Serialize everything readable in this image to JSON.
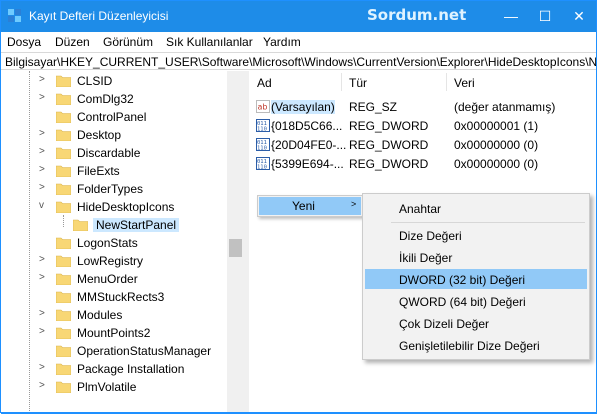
{
  "window": {
    "title": "Kayıt Defteri Düzenleyicisi",
    "brand": "Sordum.net",
    "accent_color": "#1e8ce8",
    "minimize_label": "—",
    "maximize_label": "☐",
    "close_label": "✕"
  },
  "menubar": {
    "items": [
      "Dosya",
      "Düzen",
      "Görünüm",
      "Sık Kullanılanlar",
      "Yardım"
    ]
  },
  "address": {
    "path": "Bilgisayar\\HKEY_CURRENT_USER\\Software\\Microsoft\\Windows\\CurrentVersion\\Explorer\\HideDesktopIcons\\NewStartPanel"
  },
  "tree": {
    "items": [
      {
        "label": "CLSID",
        "expander": ">"
      },
      {
        "label": "ComDlg32",
        "expander": ">"
      },
      {
        "label": "ControlPanel",
        "expander": ""
      },
      {
        "label": "Desktop",
        "expander": ">"
      },
      {
        "label": "Discardable",
        "expander": ">"
      },
      {
        "label": "FileExts",
        "expander": ">"
      },
      {
        "label": "FolderTypes",
        "expander": ">"
      },
      {
        "label": "HideDesktopIcons",
        "expander": "v"
      },
      {
        "label": "NewStartPanel",
        "expander": "",
        "child": true,
        "selected": true
      },
      {
        "label": "LogonStats",
        "expander": ""
      },
      {
        "label": "LowRegistry",
        "expander": ">"
      },
      {
        "label": "MenuOrder",
        "expander": ">"
      },
      {
        "label": "MMStuckRects3",
        "expander": ""
      },
      {
        "label": "Modules",
        "expander": ">"
      },
      {
        "label": "MountPoints2",
        "expander": ">"
      },
      {
        "label": "OperationStatusManager",
        "expander": ""
      },
      {
        "label": "Package Installation",
        "expander": ">"
      },
      {
        "label": "PlmVolatile",
        "expander": ">"
      }
    ]
  },
  "list": {
    "headers": {
      "name": "Ad",
      "type": "Tür",
      "data": "Veri"
    },
    "rows": [
      {
        "icon": "ab",
        "name": "(Varsayılan)",
        "type": "REG_SZ",
        "data": "(değer atanmamış)"
      },
      {
        "icon": "dword",
        "name": "{018D5C66...",
        "type": "REG_DWORD",
        "data": "0x00000001 (1)"
      },
      {
        "icon": "dword",
        "name": "{20D04FE0-...",
        "type": "REG_DWORD",
        "data": "0x00000000 (0)"
      },
      {
        "icon": "dword",
        "name": "{5399E694-...",
        "type": "REG_DWORD",
        "data": "0x00000000 (0)"
      }
    ]
  },
  "context_menu": {
    "new_label": "Yeni",
    "new_arrow": ">"
  },
  "submenu": {
    "key_label": "Anahtar",
    "items": [
      "Dize Değeri",
      "İkili Değer",
      "DWORD (32 bit) Değeri",
      "QWORD (64 bit) Değeri",
      "Çok Dizeli Değer",
      "Genişletilebilir Dize Değeri"
    ],
    "highlighted": "DWORD (32 bit) Değeri",
    "highlight_color": "#91c9f7"
  }
}
